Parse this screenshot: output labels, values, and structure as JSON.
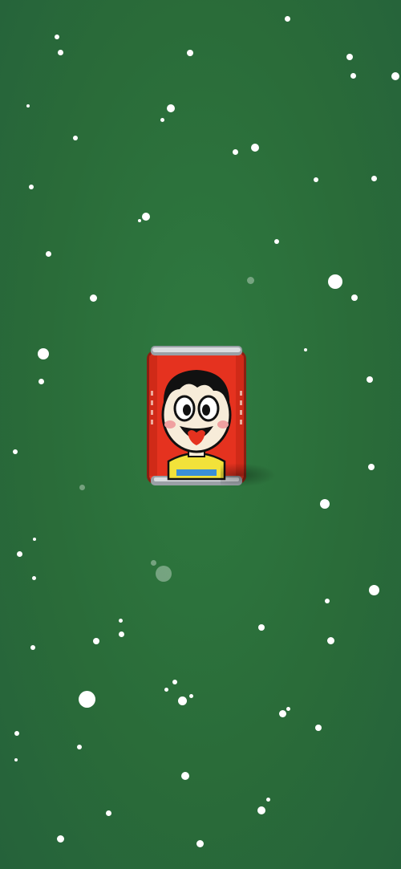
{
  "scene": {
    "background_color": "#2b6e3a",
    "snow_color": "#ffffff",
    "can": {
      "body_color": "#e5321f",
      "rim_color": "#c9c9c9",
      "face_color": "#f7ecd9",
      "hair_color": "#111111",
      "cheek_color": "#f0a0a0",
      "tongue_color": "#e5321f",
      "shirt_color": "#f2e23a"
    }
  }
}
